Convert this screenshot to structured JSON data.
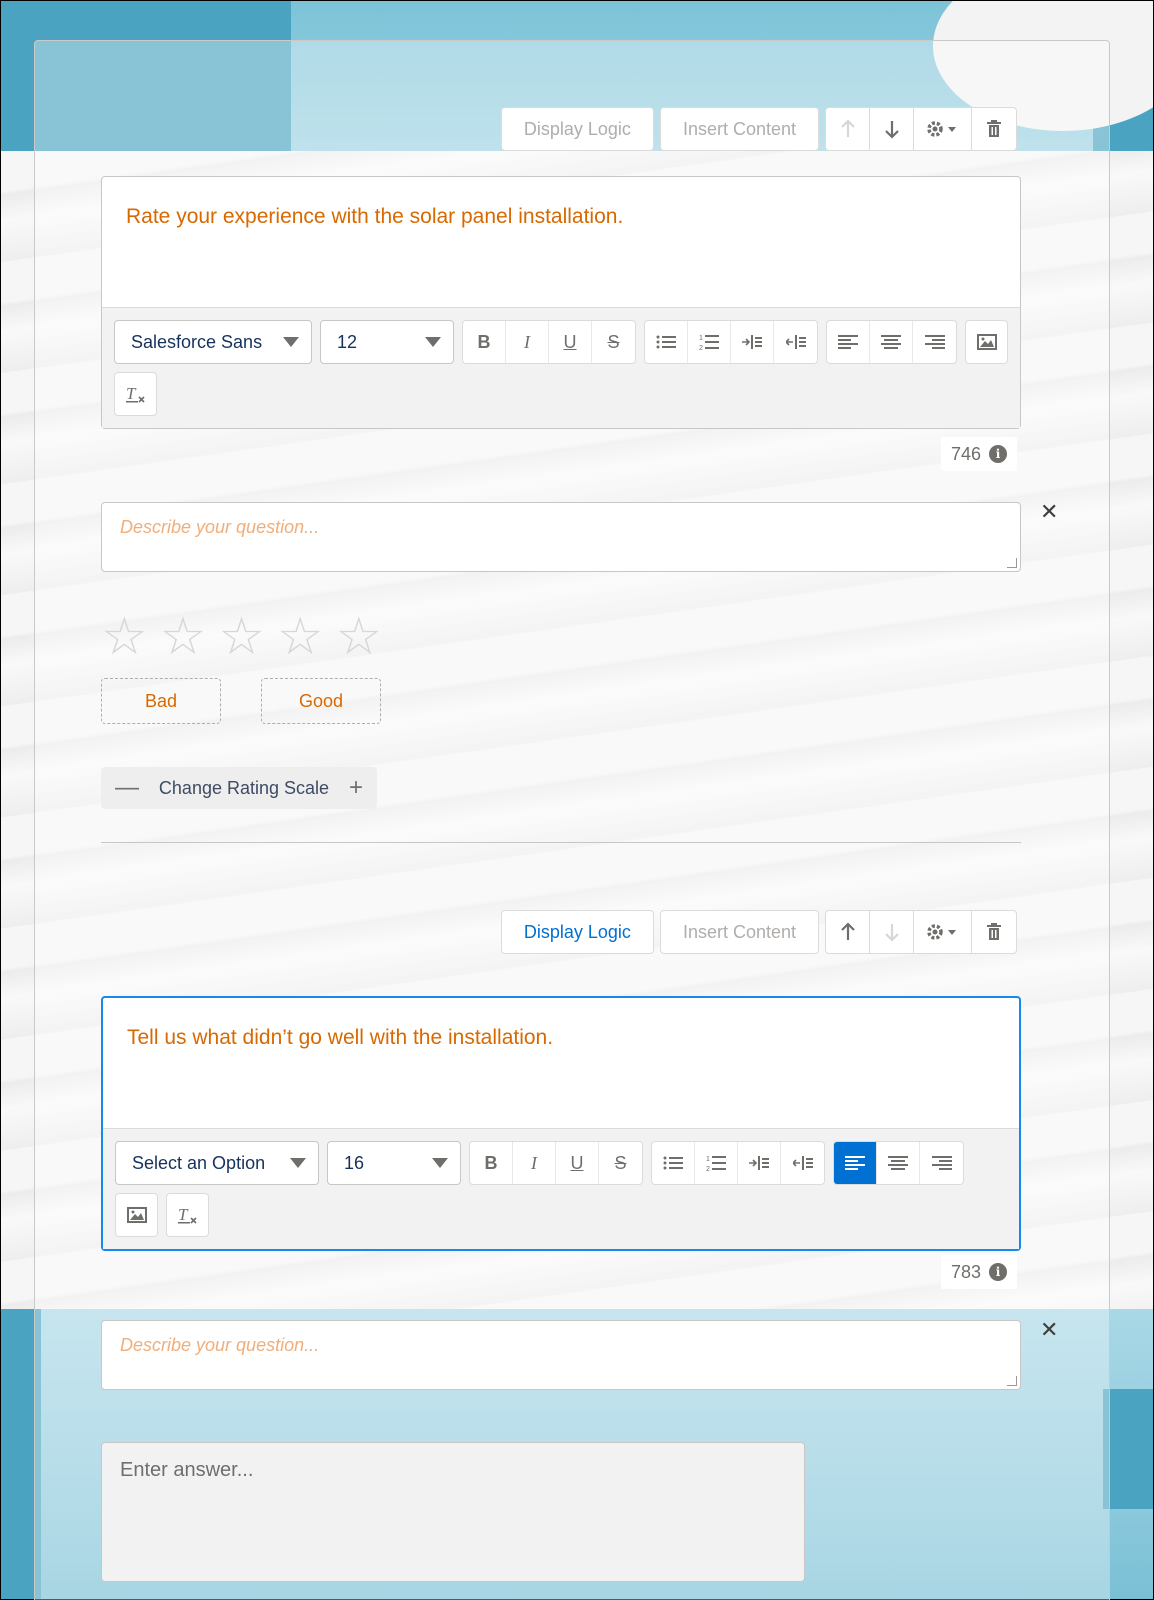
{
  "question1": {
    "toolbar": {
      "display_logic": "Display Logic",
      "insert_content": "Insert Content"
    },
    "text": "Rate your experience with the solar panel installation.",
    "font_family": "Salesforce Sans",
    "font_size": "12",
    "char_count": "746",
    "description_placeholder": "Describe your question...",
    "rating": {
      "stars": 5,
      "low_label": "Bad",
      "high_label": "Good",
      "change_scale": "Change Rating Scale"
    }
  },
  "question2": {
    "toolbar": {
      "display_logic": "Display Logic",
      "insert_content": "Insert Content"
    },
    "text": "Tell us what didn’t go well with the installation.",
    "font_family": "Select an Option",
    "font_size": "16",
    "char_count": "783",
    "description_placeholder": "Describe your question...",
    "answer_placeholder": "Enter answer..."
  },
  "colors": {
    "accent": "#0070d2",
    "question_text": "#d86900"
  }
}
